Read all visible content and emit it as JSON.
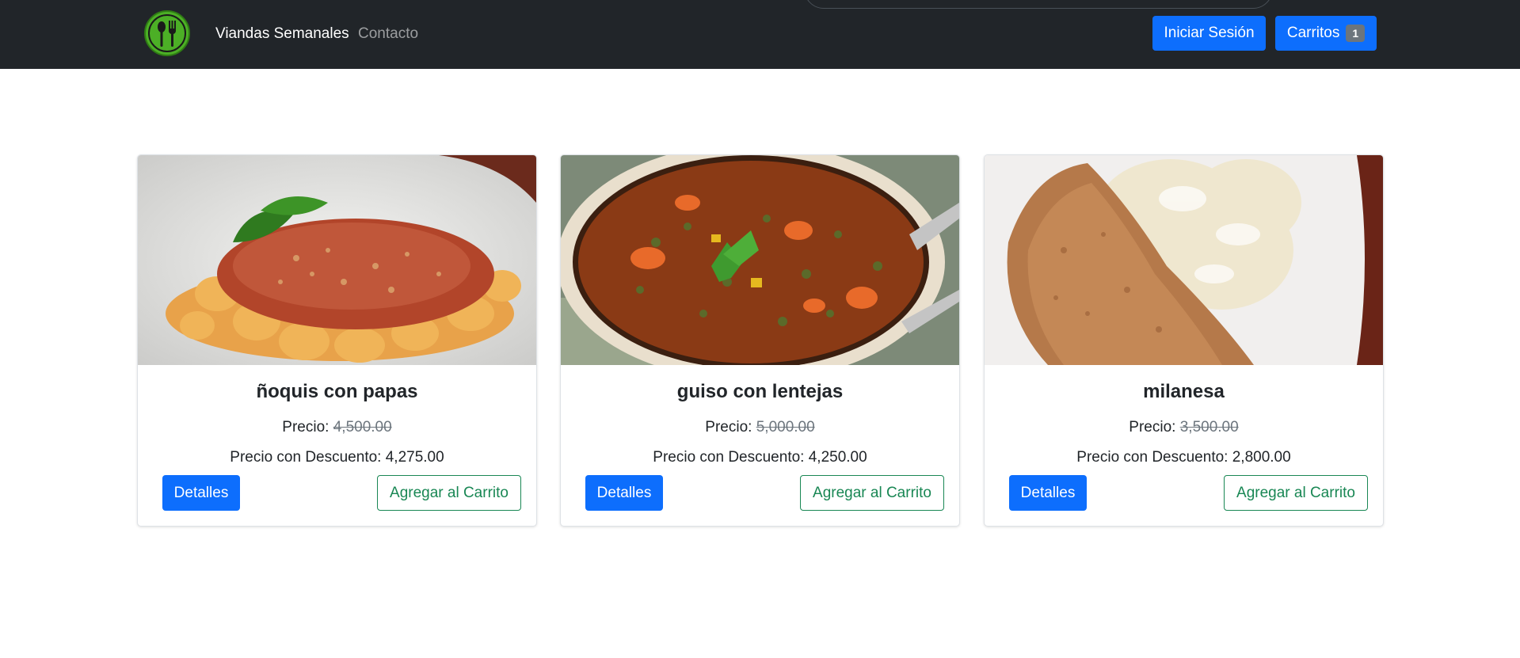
{
  "navbar": {
    "brand": "Viandas Semanales",
    "contact": "Contacto",
    "login": "Iniciar Sesión",
    "cart_label": "Carritos",
    "cart_count": "1"
  },
  "labels": {
    "price": "Precio:",
    "discount_price": "Precio con Descuento:",
    "details": "Detalles",
    "add_to_cart": "Agregar al Carrito"
  },
  "products": [
    {
      "name": "ñoquis con papas",
      "price": "4,500.00",
      "discount": "4,275.00"
    },
    {
      "name": "guiso con lentejas",
      "price": "5,000.00",
      "discount": "4,250.00"
    },
    {
      "name": "milanesa",
      "price": "3,500.00",
      "discount": "2,800.00"
    }
  ],
  "colors": {
    "navbar": "#212529",
    "primary": "#0d6efd",
    "success": "#198754",
    "logo": "#4caf26"
  },
  "icons": {
    "logo": "utensils-logo-icon"
  }
}
